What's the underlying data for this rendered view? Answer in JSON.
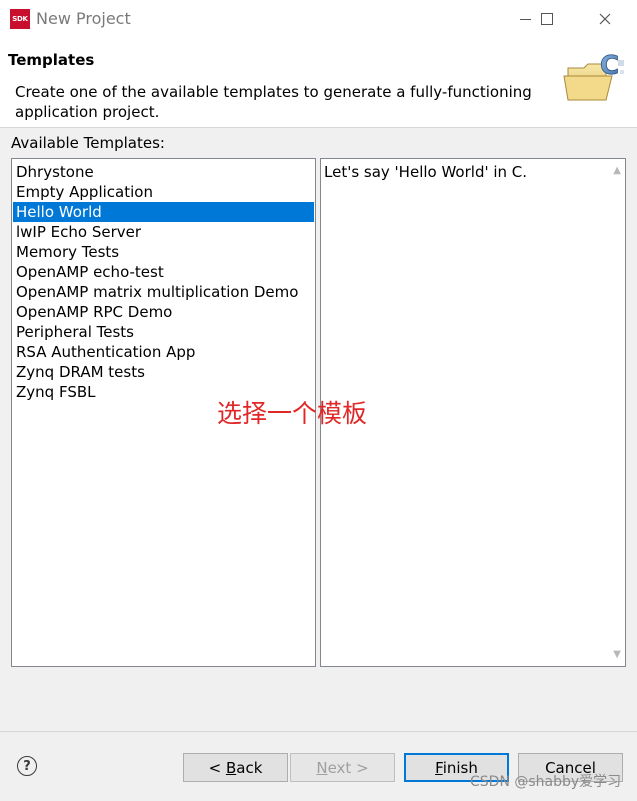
{
  "window": {
    "app_icon_text": "SDK",
    "title": "New Project",
    "controls": [
      "minimize",
      "maximize",
      "close"
    ]
  },
  "header": {
    "title": "Templates",
    "description": "Create one of the available templates to generate a fully-functioning application project.",
    "banner_icon": "new-c-project-folder-icon"
  },
  "templates": {
    "label": "Available Templates:",
    "items": [
      "Dhrystone",
      "Empty Application",
      "Hello World",
      "lwIP Echo Server",
      "Memory Tests",
      "OpenAMP echo-test",
      "OpenAMP matrix multiplication Demo",
      "OpenAMP RPC Demo",
      "Peripheral Tests",
      "RSA Authentication App",
      "Zynq DRAM tests",
      "Zynq FSBL"
    ],
    "selected": "Hello World"
  },
  "description_pane": {
    "text": "Let's say 'Hello World' in C."
  },
  "annotation": {
    "text": "选择一个模板",
    "color": "#e02828"
  },
  "buttons": {
    "help": "?",
    "back": {
      "prefix": "< ",
      "mnemonic": "B",
      "rest": "ack"
    },
    "next": {
      "mnemonic": "N",
      "rest": "ext >"
    },
    "finish": {
      "mnemonic": "F",
      "rest": "inish"
    },
    "cancel": "Cancel"
  },
  "watermark": "CSDN @shabby爱学习",
  "colors": {
    "selection": "#0078d7",
    "default_button_border": "#0078d7"
  }
}
